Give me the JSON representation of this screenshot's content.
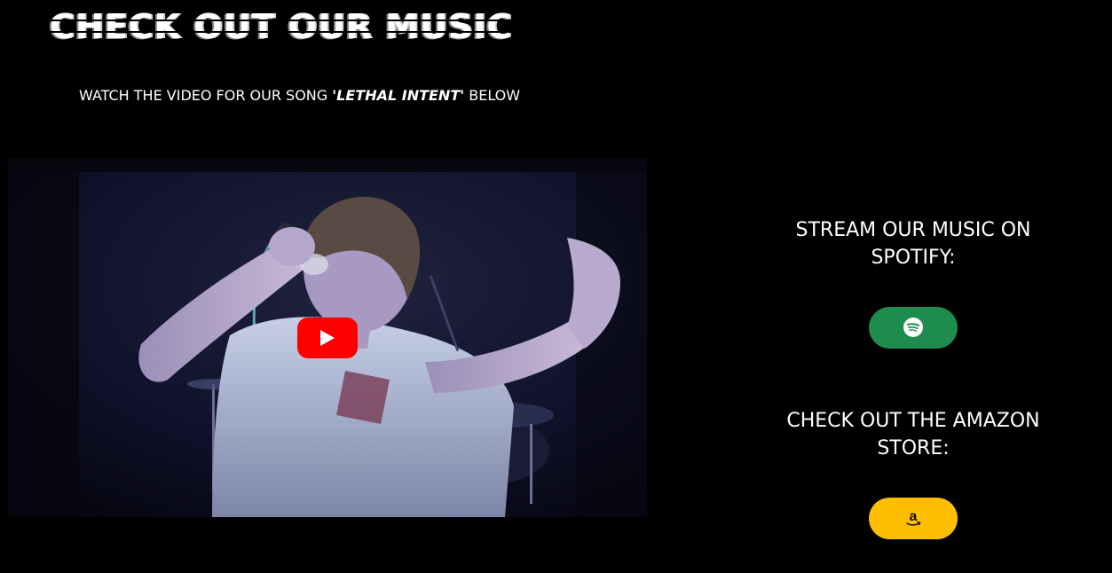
{
  "header": {
    "title": "CHECK OUT OUR MUSIC",
    "subtitle_prefix": "WATCH THE VIDEO FOR OUR SONG ",
    "subtitle_song": "'LETHAL INTENT'",
    "subtitle_suffix": " BELOW"
  },
  "video": {
    "play_icon": "play-icon",
    "player_color": "#ff0000"
  },
  "sidebar": {
    "spotify": {
      "heading": "STREAM OUR MUSIC ON SPOTIFY:",
      "icon": "spotify-icon",
      "color": "#1e8b4f"
    },
    "amazon": {
      "heading": "CHECK OUT THE AMAZON STORE:",
      "icon": "amazon-icon",
      "color": "#ffbf00"
    }
  }
}
